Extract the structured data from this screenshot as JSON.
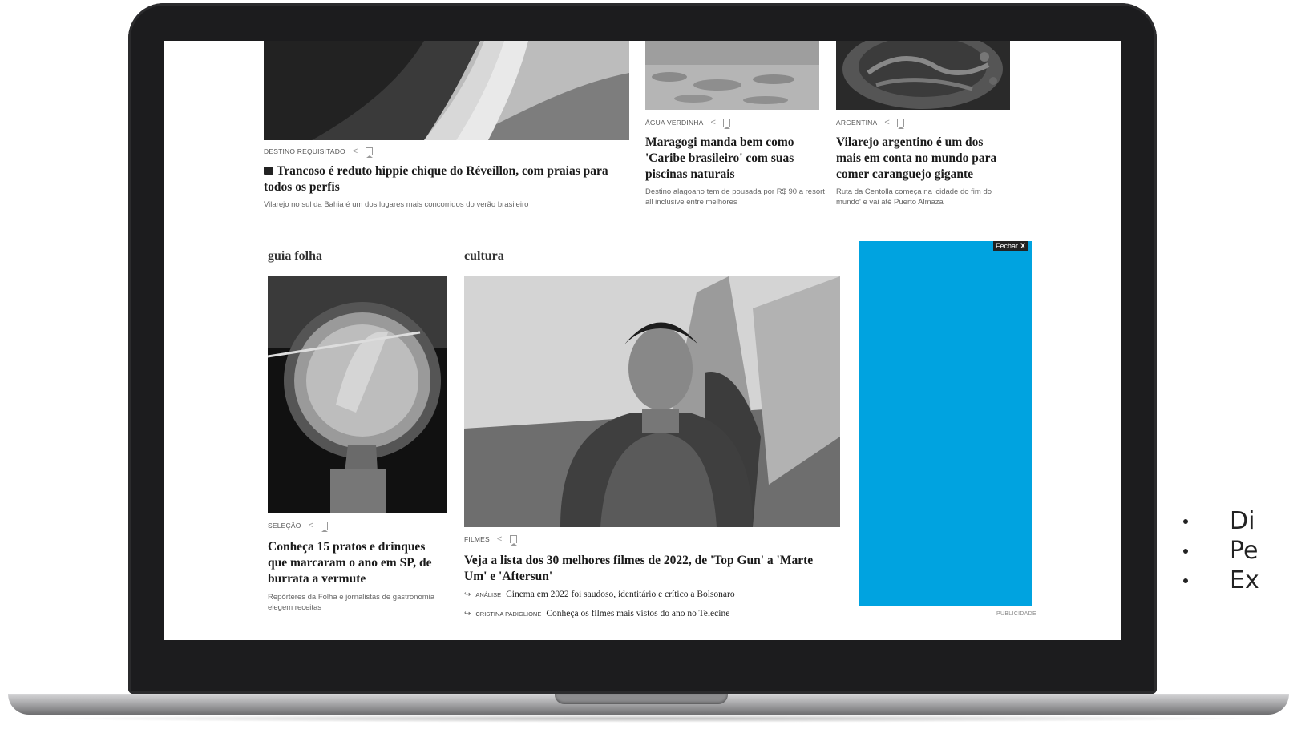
{
  "articles_top": [
    {
      "kicker": "DESTINO REQUISITADO",
      "headline": "Trancoso é reduto hippie chique do Réveillon, com praias para todos os perfis",
      "standfirst": "Vilarejo no sul da Bahia é um dos lugares mais concorridos do verão brasileiro"
    },
    {
      "kicker": "ÁGUA VERDINHA",
      "headline": "Maragogi manda bem como 'Caribe brasileiro' com suas piscinas naturais",
      "standfirst": "Destino alagoano tem de pousada por R$ 90 a resort all inclusive entre melhores"
    },
    {
      "kicker": "ARGENTINA",
      "headline": "Vilarejo argentino é um dos mais em conta no mundo para comer caranguejo gigante",
      "standfirst": "Ruta da Centolla começa na 'cidade do fim do mundo' e vai até Puerto Almaza"
    }
  ],
  "guia": {
    "section": "guia folha",
    "kicker": "SELEÇÃO",
    "headline": "Conheça 15 pratos e drinques que marcaram o ano em SP, de burrata a vermute",
    "standfirst": "Repórteres da Folha e jornalistas de gastronomia elegem receitas"
  },
  "cultura": {
    "section": "cultura",
    "kicker": "FILMES",
    "headline": "Veja a lista dos 30 melhores filmes de 2022, de 'Top Gun' a 'Marte Um' e 'Aftersun'",
    "related": [
      {
        "tag": "ANÁLISE",
        "text": "Cinema em 2022 foi saudoso, identitário e crítico a Bolsonaro"
      },
      {
        "tag": "CRISTINA PADIGLIONE",
        "text": "Conheça os filmes mais vistos do ano no Telecine"
      }
    ]
  },
  "ad": {
    "close_label": "Fechar",
    "close_x": "X",
    "label": "PUBLICIDADE",
    "color": "#00a3e0"
  },
  "side_bullets": [
    "Di",
    "Pe",
    "Ex"
  ],
  "icons": {
    "share": "share-icon",
    "bookmark": "bookmark-icon",
    "gallery": "gallery-icon",
    "arrow": "arrow-return-icon"
  },
  "colors": {
    "laptop_body": "#1c1c1e",
    "ad_blue": "#00a3e0"
  }
}
